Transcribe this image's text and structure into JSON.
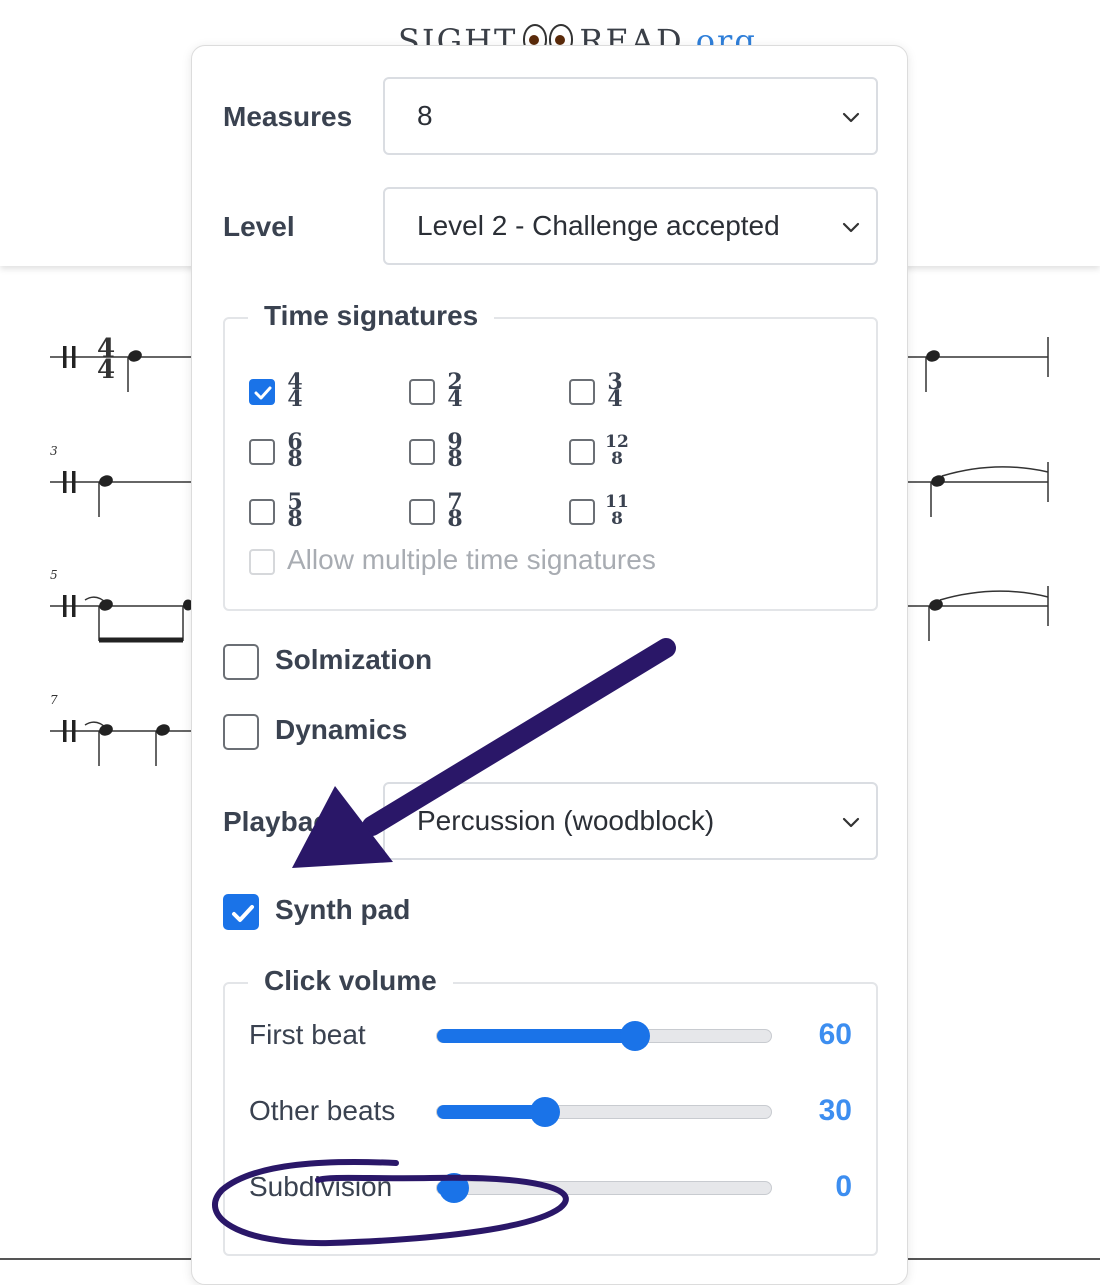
{
  "site": {
    "logo_left": "SIGHT",
    "logo_right": "READ",
    "logo_tld": ".org"
  },
  "score": {
    "measure_numbers": [
      "3",
      "5",
      "7"
    ],
    "first_time_signature": {
      "top": "4",
      "bottom": "4"
    }
  },
  "settings": {
    "measures": {
      "label": "Measures",
      "value": "8"
    },
    "level": {
      "label": "Level",
      "value": "Level 2 - Challenge accepted"
    },
    "time_signatures": {
      "legend": "Time signatures",
      "options": [
        {
          "top": "4",
          "bottom": "4",
          "checked": true
        },
        {
          "top": "2",
          "bottom": "4",
          "checked": false
        },
        {
          "top": "3",
          "bottom": "4",
          "checked": false
        },
        {
          "top": "6",
          "bottom": "8",
          "checked": false
        },
        {
          "top": "9",
          "bottom": "8",
          "checked": false
        },
        {
          "top": "12",
          "bottom": "8",
          "checked": false
        },
        {
          "top": "5",
          "bottom": "8",
          "checked": false
        },
        {
          "top": "7",
          "bottom": "8",
          "checked": false
        },
        {
          "top": "11",
          "bottom": "8",
          "checked": false
        }
      ],
      "allow_multiple": {
        "label": "Allow multiple time signatures",
        "checked": false,
        "disabled": true
      }
    },
    "solmization": {
      "label": "Solmization",
      "checked": false
    },
    "dynamics": {
      "label": "Dynamics",
      "checked": false
    },
    "playback": {
      "label": "Playback",
      "value": "Percussion (woodblock)"
    },
    "synth_pad": {
      "label": "Synth pad",
      "checked": true
    },
    "click_volume": {
      "legend": "Click volume",
      "sliders": [
        {
          "label": "First beat",
          "value": "60",
          "fraction": 0.6
        },
        {
          "label": "Other beats",
          "value": "30",
          "fraction": 0.3
        },
        {
          "label": "Subdivision",
          "value": "0",
          "fraction": 0.0
        }
      ]
    }
  },
  "colors": {
    "accent": "#1a73e8",
    "value_text": "#3d8ef0",
    "annotation": "#2a1768"
  },
  "icons": [
    "chevron-down-icon",
    "checkmark-icon",
    "arrow-annotation",
    "circle-annotation"
  ]
}
